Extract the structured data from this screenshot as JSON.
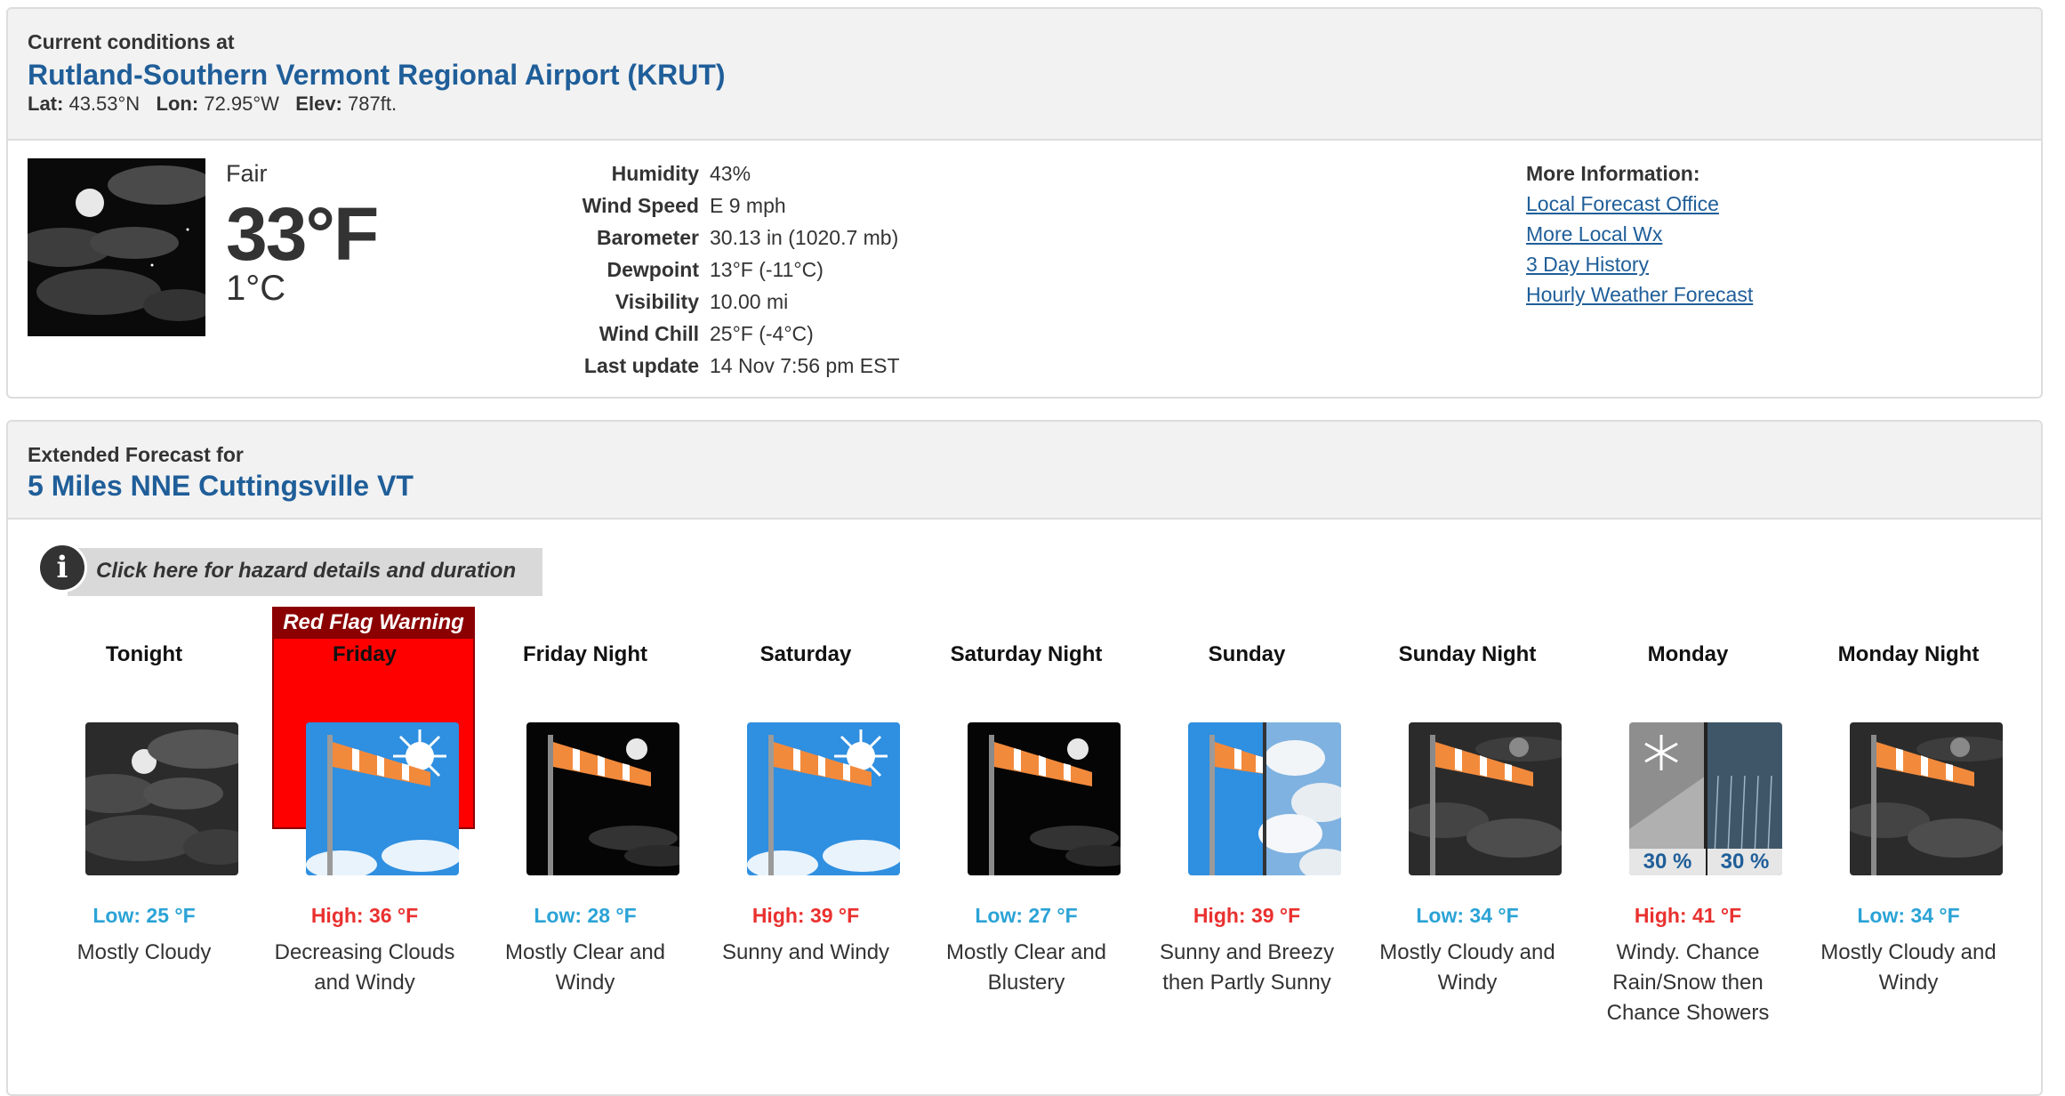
{
  "current": {
    "label": "Current conditions at",
    "station": "Rutland-Southern Vermont Regional Airport (KRUT)",
    "lat_label": "Lat:",
    "lat": "43.53°N",
    "lon_label": "Lon:",
    "lon": "72.95°W",
    "elev_label": "Elev:",
    "elev": "787ft.",
    "condition": "Fair",
    "temp_f": "33°F",
    "temp_c": "1°C",
    "details": [
      {
        "key": "Humidity",
        "value": "43%"
      },
      {
        "key": "Wind Speed",
        "value": "E 9 mph"
      },
      {
        "key": "Barometer",
        "value": "30.13 in (1020.7 mb)"
      },
      {
        "key": "Dewpoint",
        "value": "13°F (-11°C)"
      },
      {
        "key": "Visibility",
        "value": "10.00 mi"
      },
      {
        "key": "Wind Chill",
        "value": "25°F (-4°C)"
      },
      {
        "key": "Last update",
        "value": "14 Nov 7:56 pm EST"
      }
    ],
    "more_info": {
      "title": "More Information:",
      "links": [
        "Local Forecast Office",
        "More Local Wx",
        "3 Day History",
        "Hourly Weather Forecast"
      ]
    }
  },
  "extended": {
    "label": "Extended Forecast for",
    "location": "5 Miles NNE Cuttingsville VT",
    "hazard_link": "Click here for hazard details and duration",
    "warning_label": "Red Flag Warning",
    "days": [
      {
        "name": "Tonight",
        "temp": "Low: 25 °F",
        "description": "Mostly Cloudy",
        "icon": "night-mostly-cloudy-icon"
      },
      {
        "name": "Friday",
        "temp": "High: 36 °F",
        "description": "Decreasing Clouds and Windy",
        "icon": "sunny-windy-icon"
      },
      {
        "name": "Friday Night",
        "temp": "Low: 28 °F",
        "description": "Mostly Clear and Windy",
        "icon": "night-clear-windy-icon"
      },
      {
        "name": "Saturday",
        "temp": "High: 39 °F",
        "description": "Sunny and Windy",
        "icon": "sunny-windy-icon"
      },
      {
        "name": "Saturday Night",
        "temp": "Low: 27 °F",
        "description": "Mostly Clear and Blustery",
        "icon": "night-clear-windy-icon"
      },
      {
        "name": "Sunday",
        "temp": "High: 39 °F",
        "description": "Sunny and Breezy then Partly Sunny",
        "icon": "sunny-breezy-then-partly-sunny-icon"
      },
      {
        "name": "Sunday Night",
        "temp": "Low: 34 °F",
        "description": "Mostly Cloudy and Windy",
        "icon": "night-cloudy-windy-icon"
      },
      {
        "name": "Monday",
        "temp": "High: 41 °F",
        "description": "Windy. Chance Rain/Snow then Chance Showers",
        "icon": "rain-snow-then-showers-icon",
        "pop": [
          "30 %",
          "30 %"
        ]
      },
      {
        "name": "Monday Night",
        "temp": "Low: 34 °F",
        "description": "Mostly Cloudy and Windy",
        "icon": "night-cloudy-windy-icon"
      }
    ]
  },
  "colors": {
    "title_blue": "#1f5e99",
    "low_temp": "#2ba3d6",
    "high_temp": "#e9312f",
    "red_flag": "#ff0000"
  }
}
